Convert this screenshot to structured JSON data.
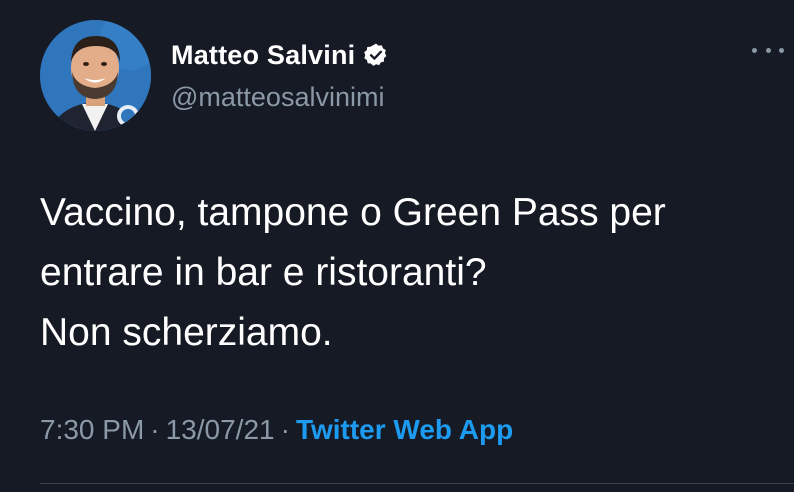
{
  "author": {
    "display_name": "Matteo Salvini",
    "handle": "@matteosalvinimi",
    "verified": true
  },
  "tweet": {
    "lines": [
      "Vaccino, tampone o Green Pass per",
      "entrare in bar e ristoranti?",
      "Non scherziamo."
    ]
  },
  "meta": {
    "time": "7:30 PM",
    "separator": "·",
    "date": "13/07/21",
    "source": "Twitter Web App"
  },
  "icons": {
    "verified": "verified-badge-icon",
    "more": "more-options-icon"
  },
  "colors": {
    "background": "#151a25",
    "secondary_text": "#8b98a5",
    "link": "#1d9bf0",
    "verified_badge": "#ffffff"
  }
}
